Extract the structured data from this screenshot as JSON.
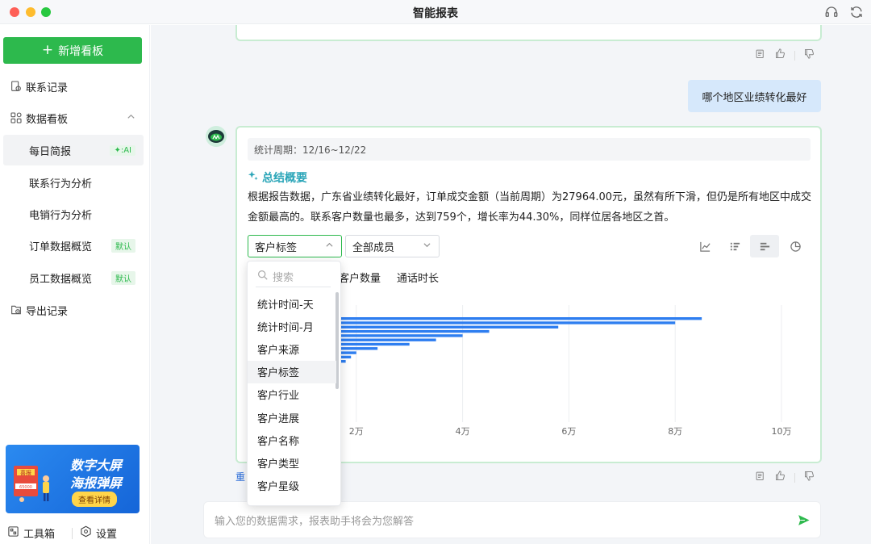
{
  "app": {
    "title": "智能报表"
  },
  "sidebar": {
    "new_button": "新增看板",
    "items": [
      {
        "label": "联系记录",
        "icon": "contact-record-icon"
      },
      {
        "label": "数据看板",
        "icon": "dashboard-grid-icon"
      },
      {
        "label": "每日简报",
        "badge": "AI"
      },
      {
        "label": "联系行为分析"
      },
      {
        "label": "电销行为分析"
      },
      {
        "label": "订单数据概览",
        "badge": "默认"
      },
      {
        "label": "员工数据概览",
        "badge": "默认"
      },
      {
        "label": "导出记录",
        "icon": "export-record-icon"
      }
    ],
    "promo": {
      "line1": "数字大屏",
      "line2": "海报弹屏",
      "cta": "查看详情",
      "art_text": "喜报",
      "art_amount": "65000"
    },
    "toolbox": "工具箱",
    "settings": "设置"
  },
  "conversation": {
    "user_question": "哪个地区业绩转化最好",
    "report": {
      "period": "统计周期：12/16~12/22",
      "summary_title": "总结概要",
      "summary_text": "根据报告数据，广东省业绩转化最好，订单成交金额（当前周期）为27964.00元，虽然有所下滑，但仍是所有地区中成交金额最高的。联系客户数量也最多，达到759个，增长率为44.30%，同样位居各地区之首。",
      "dimension_select": "客户标签",
      "member_select": "全部成员",
      "metric_tabs": [
        "系客户数量",
        "通话时长"
      ],
      "chart_types": [
        "line-chart-icon",
        "column-chart-icon",
        "bar-chart-icon",
        "pie-chart-icon"
      ],
      "regenerate": "重"
    }
  },
  "chart_data": {
    "type": "bar",
    "orientation": "horizontal",
    "xlim": [
      0,
      100000
    ],
    "x_ticks": [
      "2万",
      "4万",
      "6万",
      "8万",
      "10万"
    ],
    "values": [
      85000,
      80000,
      58000,
      45000,
      40000,
      35000,
      30000,
      24000,
      20000,
      19000,
      18000,
      17000,
      16000,
      15000,
      14000,
      12000,
      9000,
      6000,
      5000,
      4000,
      3000
    ],
    "color": "#2e7ef0"
  },
  "dropdown": {
    "search_placeholder": "搜索",
    "options": [
      "统计时间-天",
      "统计时间-月",
      "客户来源",
      "客户标签",
      "客户行业",
      "客户进展",
      "客户名称",
      "客户类型",
      "客户星级"
    ],
    "highlighted": "客户标签"
  },
  "input": {
    "placeholder": "输入您的数据需求，报表助手将会为您解答"
  },
  "colors": {
    "accent": "#2db94d",
    "card_border": "#c8ecd2",
    "user_bubble": "#d6e8fb",
    "bar": "#2e7ef0"
  }
}
